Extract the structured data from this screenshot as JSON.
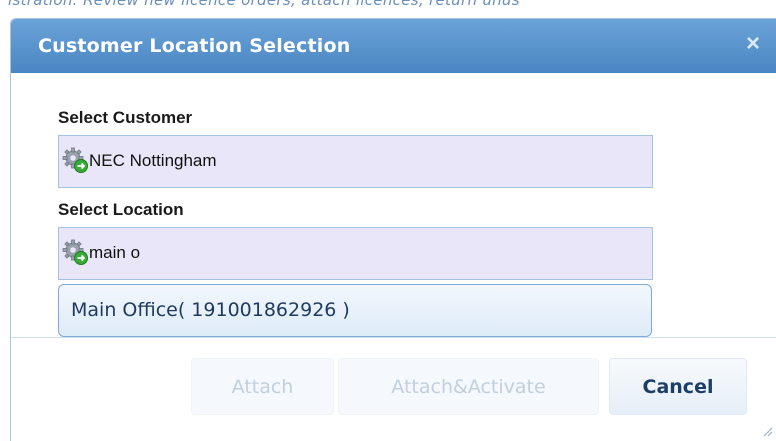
{
  "background": {
    "text": "istration: Review new licence orders, attach licences, return unus"
  },
  "dialog": {
    "title": "Customer Location Selection",
    "close_label": "×"
  },
  "customer": {
    "label": "Select Customer",
    "value": "NEC Nottingham",
    "icon": "gear-icon"
  },
  "location": {
    "label": "Select Location",
    "value": "main o",
    "icon": "gear-icon",
    "suggestions": [
      "Main Office( 191001862926 )"
    ]
  },
  "buttons": {
    "attach": "Attach",
    "attach_activate": "Attach&Activate",
    "cancel": "Cancel"
  },
  "colors": {
    "titlebar": "#4a86c2",
    "field_bg": "#e8e6f8",
    "field_border": "#a4c3e2",
    "suggestion_border": "#7eaad6"
  }
}
